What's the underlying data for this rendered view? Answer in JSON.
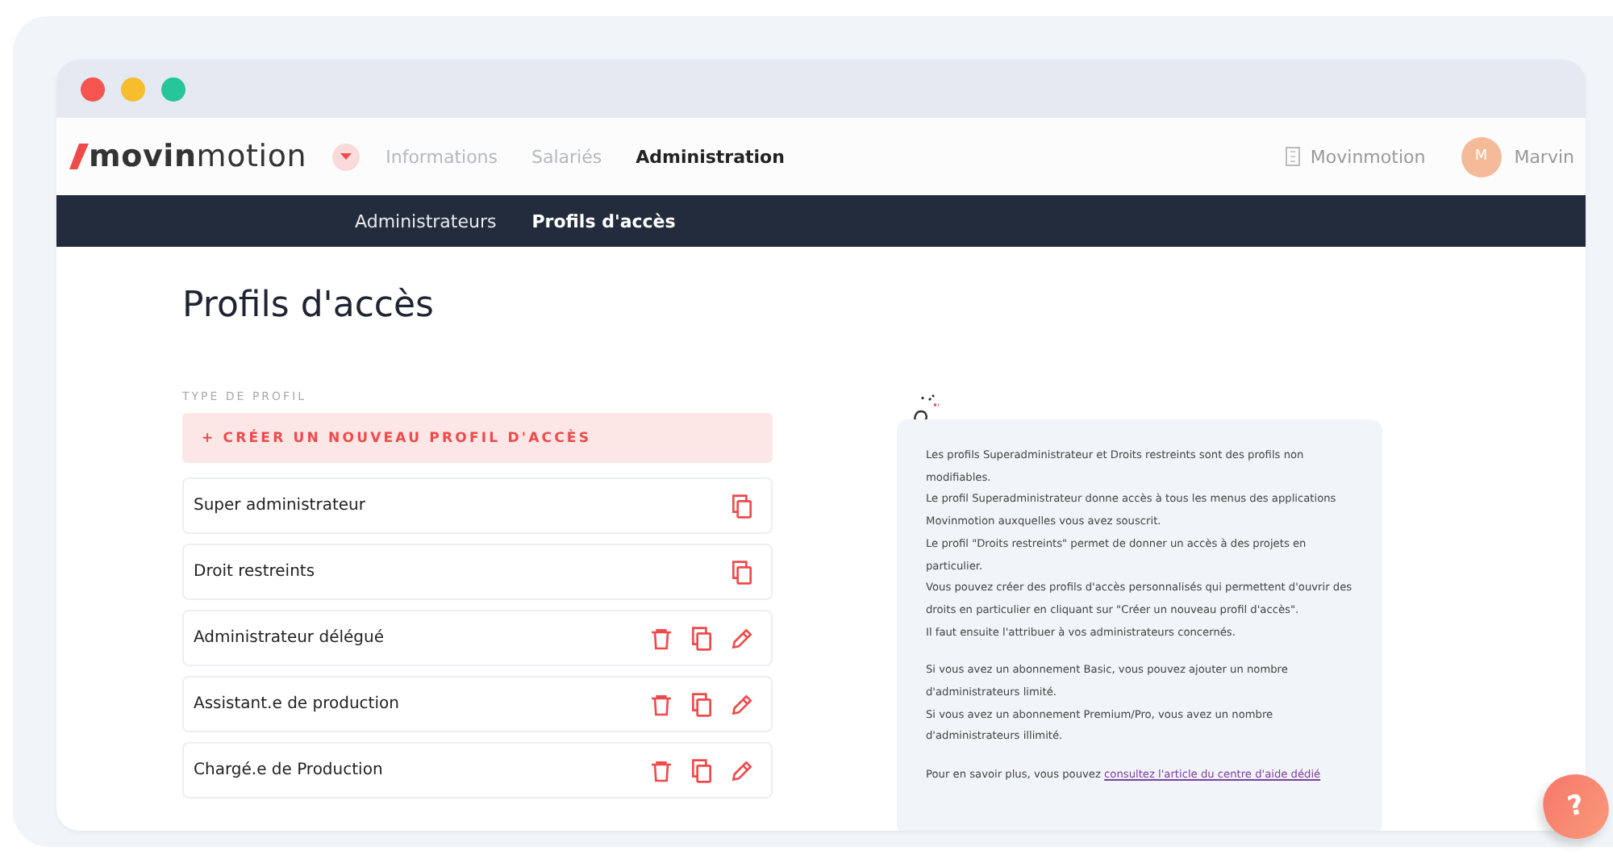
{
  "app": {
    "logo_bold": "movin",
    "logo_light": "motion",
    "nav": [
      {
        "label": "Informations",
        "selected": false
      },
      {
        "label": "Salariés",
        "selected": false
      },
      {
        "label": "Administration",
        "selected": true
      }
    ],
    "company": "Movinmotion",
    "user": {
      "initial": "M",
      "name": "Marvin"
    }
  },
  "subnav": [
    {
      "label": "Administrateurs",
      "selected": false
    },
    {
      "label": "Profils d'accès",
      "selected": true
    }
  ],
  "page_title": "Profils d'accès",
  "section_label": "TYPE DE PROFIL",
  "create_button": "+ CRÉER UN NOUVEAU PROFIL D'ACCÈS",
  "profiles": [
    {
      "label": "Super administrateur",
      "kind": "locked"
    },
    {
      "label": "Droit restreints",
      "kind": "locked"
    },
    {
      "label": "Administrateur délégué",
      "kind": "editable"
    },
    {
      "label": "Assistant.e de production",
      "kind": "editable"
    },
    {
      "label": "Chargé.e de Production",
      "kind": "editable"
    }
  ],
  "info": {
    "paragraphs": [
      [
        "Les profils Superadministrateur et Droits restreints sont des profils non modifiables.",
        "Le profil Superadministrateur donne accès à tous les menus des applications Movinmotion auxquelles vous avez souscrit.",
        "Le profil \"Droits restreints\" permet de donner un accès à des projets en particulier.",
        "Vous pouvez créer des profils d'accès personnalisés qui permettent d'ouvrir des droits en particulier en cliquant sur \"Créer un nouveau profil d'accès\".",
        "Il faut ensuite l'attribuer à vos administrateurs concernés."
      ],
      [
        "Si vous avez un abonnement Basic, vous pouvez ajouter un nombre d'administrateurs limité.",
        "Si vous avez un abonnement Premium/Pro, vous avez un nombre d'administrateurs illimité."
      ]
    ],
    "more_text": "Pour en savoir plus, vous pouvez",
    "more_link": "consultez l'article du centre d'aide dédié"
  },
  "help_button": "?"
}
